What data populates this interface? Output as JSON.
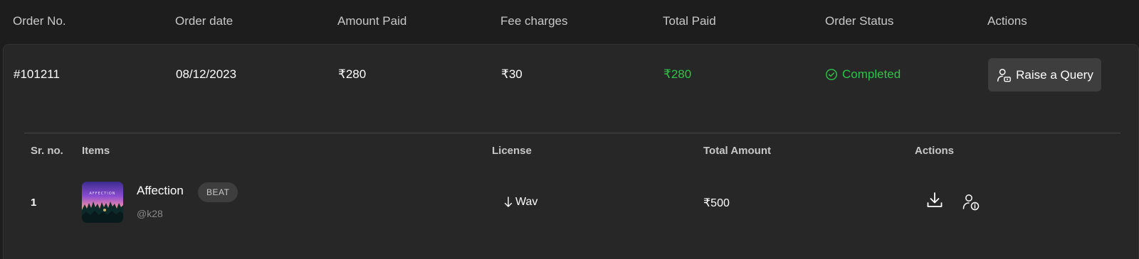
{
  "header": {
    "order_no": "Order No.",
    "order_date": "Order date",
    "amount_paid": "Amount Paid",
    "fee_charges": "Fee charges",
    "total_paid": "Total Paid",
    "order_status": "Order Status",
    "actions": "Actions"
  },
  "order": {
    "number": "#101211",
    "date": "08/12/2023",
    "amount_paid": "₹280",
    "fee": "₹30",
    "total_paid": "₹280",
    "status": "Completed",
    "status_color": "#2ec447",
    "query_button": "Raise a Query"
  },
  "items_table": {
    "headers": {
      "sr": "Sr. no.",
      "items": "Items",
      "license": "License",
      "total_amount": "Total Amount",
      "actions": "Actions"
    },
    "rows": [
      {
        "sr": "1",
        "title": "Affection",
        "badge": "BEAT",
        "artist": "@k28",
        "license": "Wav",
        "amount": "₹500",
        "thumbnail_text": "AFFECTION"
      }
    ]
  },
  "icons": {
    "status": "check-circle-icon",
    "query": "user-support-icon",
    "license": "download-arrow-icon",
    "download": "download-icon",
    "info": "user-info-icon"
  }
}
